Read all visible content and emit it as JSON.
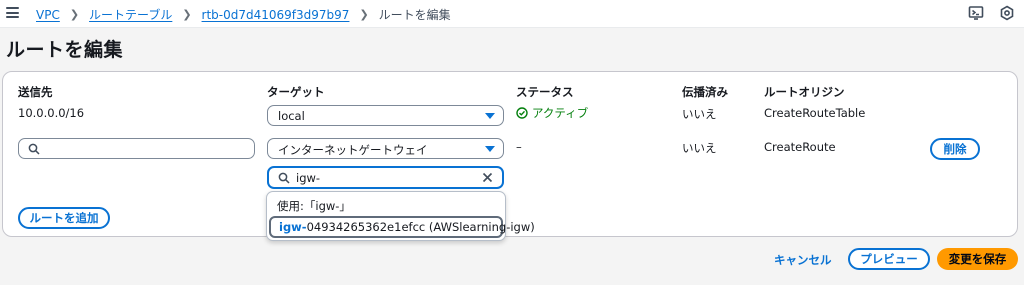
{
  "breadcrumb": {
    "items": [
      "VPC",
      "ルートテーブル",
      "rtb-0d7d41069f3d97b97"
    ],
    "current": "ルートを編集"
  },
  "page": {
    "title": "ルートを編集"
  },
  "table": {
    "headers": {
      "destination": "送信先",
      "target": "ターゲット",
      "status": "ステータス",
      "propagated": "伝播済み",
      "origin": "ルートオリジン"
    },
    "rows": [
      {
        "destination": "10.0.0.0/16",
        "target": "local",
        "status": "アクティブ",
        "propagated": "いいえ",
        "origin": "CreateRouteTable"
      },
      {
        "destination": "",
        "target": "インターネットゲートウェイ",
        "status": "–",
        "propagated": "いいえ",
        "origin": "CreateRoute",
        "remove_label": "削除",
        "target_search": "igw-"
      }
    ]
  },
  "dropdown": {
    "use_option": "使用:「igw-」",
    "option_match": "igw-",
    "option_rest": "04934265362e1efcc (AWSlearning-igw)"
  },
  "buttons": {
    "add_route": "ルートを追加",
    "cancel": "キャンセル",
    "preview": "プレビュー",
    "save": "変更を保存"
  },
  "colors": {
    "link": "#0972d3",
    "success": "#037f0c",
    "primary": "#ff9900"
  },
  "icons": [
    "menu-icon",
    "chevron-right-icon",
    "cloudshell-icon",
    "settings-icon",
    "search-icon",
    "check-circle-icon",
    "caret-down-icon",
    "clear-icon"
  ]
}
